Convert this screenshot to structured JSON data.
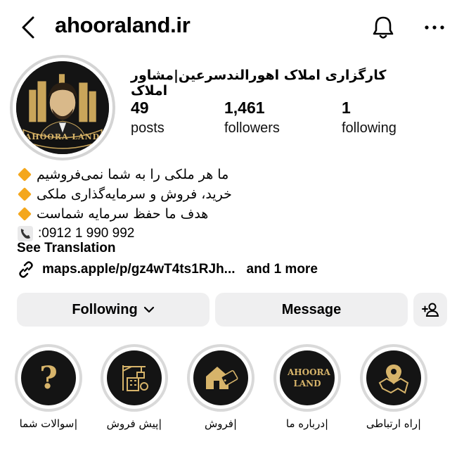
{
  "header": {
    "username": "ahooraland.ir",
    "back_icon": "chevron-left-icon",
    "bell_icon": "bell-icon",
    "more_icon": "ellipsis-icon"
  },
  "profile": {
    "display_name": "کارگزاری املاک اهورالندسرعین|مشاور املاک",
    "avatar_text": "AHOORA LAND",
    "stats": [
      {
        "value": "49",
        "label": "posts"
      },
      {
        "value": "1,461",
        "label": "followers"
      },
      {
        "value": "1",
        "label": "following"
      }
    ]
  },
  "bio": {
    "lines": [
      "ما هر ملکی را به شما نمی‌فروشیم",
      "خرید، فروش و سرمایه‌گذاری ملکی",
      "هدف ما حفظ سرمایه شماست"
    ],
    "phone": ":0912 1 990 992",
    "see_translation": "See Translation",
    "link_text": "maps.apple/p/gz4wT4ts1RJh...",
    "link_more": "and 1 more"
  },
  "actions": {
    "following_label": "Following",
    "message_label": "Message"
  },
  "highlights": [
    {
      "label": "|سوالات شما",
      "icon": "question-mark-icon"
    },
    {
      "label": "|پیش فروش",
      "icon": "construction-icon"
    },
    {
      "label": "|فروش",
      "icon": "house-sale-icon"
    },
    {
      "label": "|درباره ما",
      "icon": "logo-text-icon",
      "logo_text": "AHOORA LAND"
    },
    {
      "label": "|راه ارتباطی",
      "icon": "map-pin-icon"
    }
  ],
  "colors": {
    "accent_gold": "#d7b46a",
    "diamond": "#f4a71d",
    "button_bg": "#efeff0"
  }
}
